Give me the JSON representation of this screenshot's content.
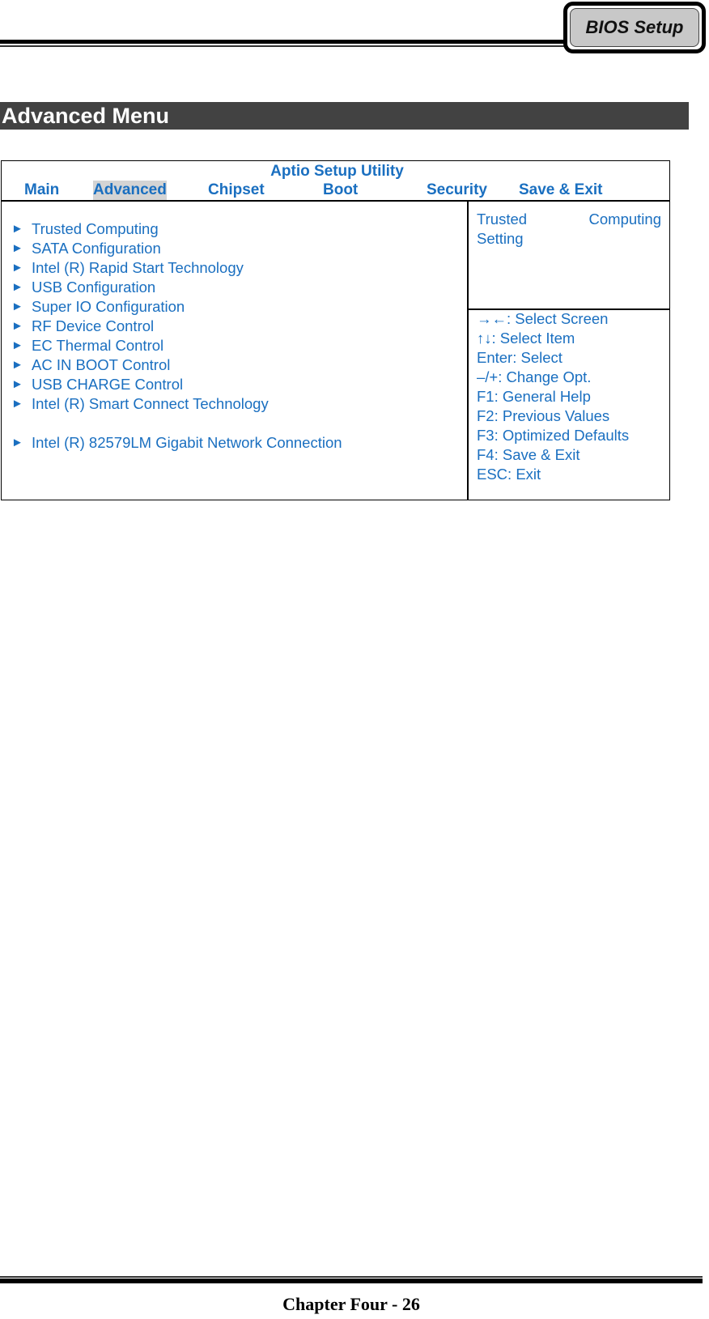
{
  "header": {
    "tab_label": "BIOS Setup"
  },
  "section": {
    "title": "Advanced Menu"
  },
  "bios": {
    "utility_title": "Aptio Setup Utility",
    "tabs": [
      {
        "label": "Main",
        "active": false
      },
      {
        "label": "Advanced",
        "active": true
      },
      {
        "label": "Chipset",
        "active": false
      },
      {
        "label": "Boot",
        "active": false
      },
      {
        "label": "Security",
        "active": false
      },
      {
        "label": "Save & Exit",
        "active": false
      }
    ],
    "arrow_glyph": "►",
    "menu_items": [
      "Trusted Computing",
      "SATA Configuration",
      "Intel (R) Rapid Start Technology",
      "USB Configuration",
      "Super IO Configuration",
      "RF Device Control",
      "EC Thermal Control",
      "AC IN BOOT Control",
      "USB CHARGE Control",
      "Intel (R) Smart Connect Technology",
      "Intel (R) 82579LM Gigabit Network Connection"
    ],
    "help_text": {
      "line1_left": "Trusted",
      "line1_right": "Computing",
      "line2": "Setting"
    },
    "key_help": [
      "→←: Select Screen",
      "↑↓: Select Item",
      "Enter: Select",
      "–/+: Change Opt.",
      "F1: General Help",
      "F2: Previous Values",
      "F3: Optimized Defaults",
      "F4: Save & Exit",
      "ESC: Exit"
    ]
  },
  "footer": {
    "page_label": "Chapter Four - 26"
  }
}
